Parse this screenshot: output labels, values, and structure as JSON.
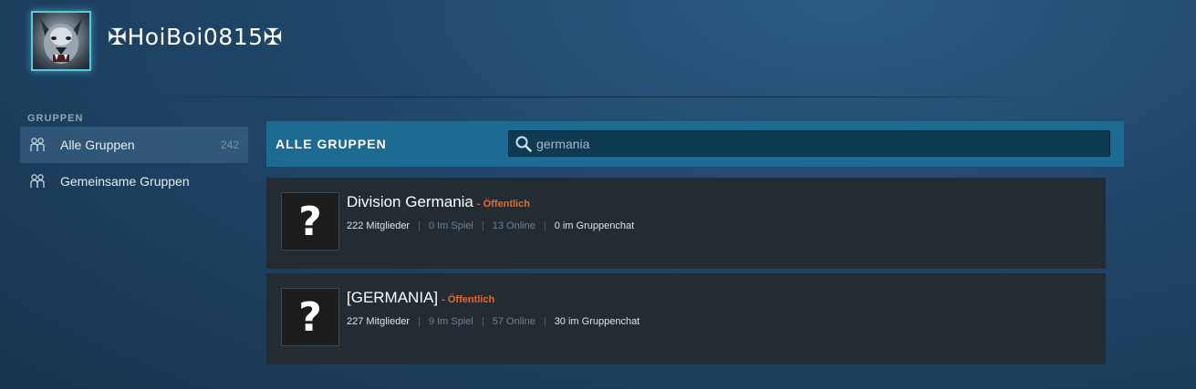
{
  "profile": {
    "username": "✠HoiBoi0815✠"
  },
  "sidebar": {
    "heading": "GRUPPEN",
    "items": [
      {
        "label": "Alle Gruppen",
        "count": "242",
        "icon": "users-icon",
        "active": true
      },
      {
        "label": "Gemeinsame Gruppen",
        "icon": "users-icon",
        "active": false
      }
    ]
  },
  "main": {
    "title": "ALLE GRUPPEN",
    "search": {
      "value": "germania",
      "icon": "search-icon"
    },
    "groups": [
      {
        "name": "Division Germania",
        "visibility": "- Öffentlich",
        "avatar_glyph": "?",
        "members": "222 Mitglieder",
        "in_game": "0 Im Spiel",
        "online": "13 Online",
        "in_chat": "0 im Gruppenchat"
      },
      {
        "name": "[GERMANIA]",
        "visibility": "- Öffentlich",
        "avatar_glyph": "?",
        "members": "227 Mitglieder",
        "in_game": "9 Im Spiel",
        "online": "57 Online",
        "in_chat": "30 im Gruppenchat"
      }
    ]
  },
  "colors": {
    "accent": "#1d6a93",
    "avatar_border": "#57cbde",
    "visibility": "#e56b2e",
    "row_bg": "#232b33"
  }
}
